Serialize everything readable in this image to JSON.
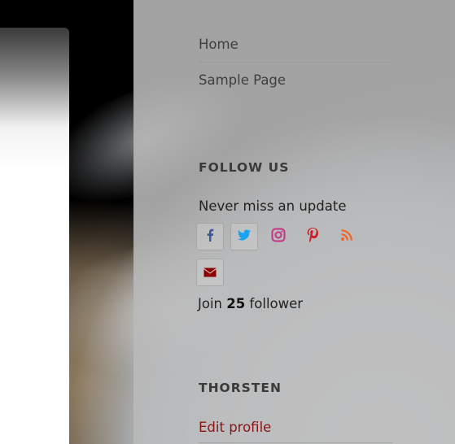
{
  "nav": {
    "items": [
      {
        "label": "Home"
      },
      {
        "label": "Sample Page"
      }
    ]
  },
  "follow_widget": {
    "title": "FOLLOW US",
    "tagline": "Never miss an update",
    "icons": [
      {
        "name": "facebook-icon",
        "color": "#3b5998"
      },
      {
        "name": "twitter-icon",
        "color": "#1da1f2"
      },
      {
        "name": "instagram-icon",
        "color": "#c13584"
      },
      {
        "name": "pinterest-icon",
        "color": "#cb2027"
      },
      {
        "name": "rss-icon",
        "color": "#f26522"
      },
      {
        "name": "email-icon",
        "color": "#8b0000"
      }
    ],
    "join_prefix": "Join",
    "follower_count": "25",
    "join_suffix": "follower"
  },
  "user_widget": {
    "title": "THORSTEN",
    "edit_profile": "Edit profile"
  },
  "colors": {
    "link_red": "#8b1414",
    "sidebar_bg": "#b9b9b9"
  }
}
